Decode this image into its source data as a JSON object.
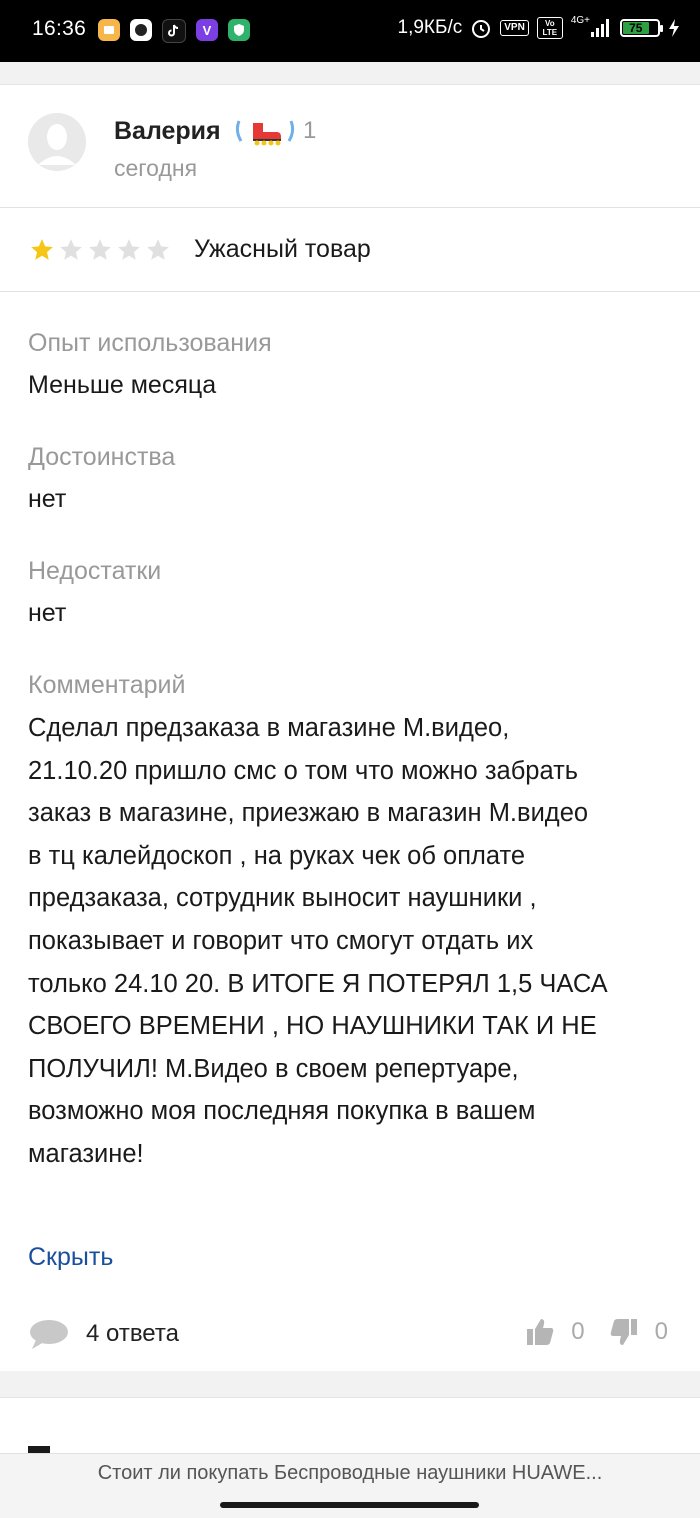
{
  "status_bar": {
    "time": "16:36",
    "net_speed": "1,9КБ/с",
    "vpn": "VPN",
    "volte": "Vo LTE",
    "network": "4G+",
    "battery": "75",
    "battery_level": 0.75
  },
  "review": {
    "author": "Валерия",
    "badge_count": "1",
    "date": "сегодня",
    "rating": 1,
    "rating_max": 5,
    "title": "Ужасный товар",
    "sections": [
      {
        "label": "Опыт использования",
        "value": "Меньше месяца"
      },
      {
        "label": "Достоинства",
        "value": "нет"
      },
      {
        "label": "Недостатки",
        "value": "нет"
      }
    ],
    "comment_label": "Комментарий",
    "comment": "Сделал предзаказа в магазине М.видео,\n21.10.20 пришло смс о том что можно забрать\nзаказ в магазине, приезжаю в магазин М.видео\nв  тц калейдоскоп , на руках чек об оплате\nпредзаказа, сотрудник выносит наушники ,\nпоказывает  и говорит что смогут отдать их\nтолько 24.10 20. В ИТОГЕ Я ПОТЕРЯЛ 1,5 ЧАСА\nСВОЕГО ВРЕМЕНИ , НО НАУШНИКИ ТАК И НЕ\nПОЛУЧИЛ! М.Видео в своем репертуаре,\nвозможно моя последняя покупка в вашем\nмагазине!",
    "hide_label": "Скрыть",
    "replies_label": "4 ответа",
    "likes": "0",
    "dislikes": "0"
  },
  "bottom_bar": {
    "title": "Стоит ли покупать Беспроводные наушники HUAWE..."
  },
  "colors": {
    "star_active": "#f5c518",
    "star_inactive": "#e0e0e0",
    "link": "#1a4f9c",
    "muted": "#999999"
  }
}
